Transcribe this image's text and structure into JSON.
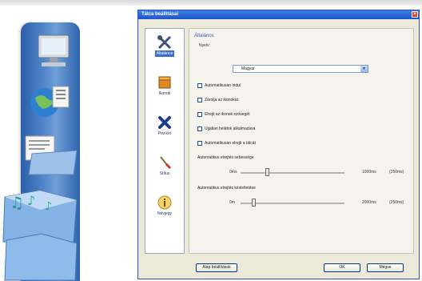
{
  "dialog": {
    "title": "Tálca beállításai",
    "close_glyph": "×"
  },
  "sidebar": {
    "items": [
      {
        "label": "Általános",
        "icon": "tools-icon",
        "active": true
      },
      {
        "label": "Ikonok",
        "icon": "box-icon",
        "active": false
      },
      {
        "label": "Pozíció",
        "icon": "x-icon",
        "active": false
      },
      {
        "label": "Stílus",
        "icon": "brush-icon",
        "active": false
      },
      {
        "label": "Névjegy",
        "icon": "info-icon",
        "active": false
      }
    ]
  },
  "general": {
    "section_title": "Általános",
    "language_label": "Nyelv:",
    "language_value": "Magyar",
    "checkboxes": [
      {
        "label": "Automatikusan indul",
        "checked": false
      },
      {
        "label": "Zárolja az ikonokat",
        "checked": false
      },
      {
        "label": "Elrejti az ikonok szövegét",
        "checked": false
      },
      {
        "label": "Ujjatlan helátok alkalmazása",
        "checked": false
      },
      {
        "label": "Automatikusan elrejti a tálcát",
        "checked": false
      }
    ],
    "slider1": {
      "label": "Automatikus elrejtés sebessége",
      "min": "0ms",
      "max": "1000ms",
      "value": "(250ms)",
      "fraction": 0.25
    },
    "slider2": {
      "label": "Automatikus elrejtés késleltetése",
      "min": "0m",
      "max": "2000ms",
      "value": "(250ms)",
      "fraction": 0.12
    }
  },
  "buttons": {
    "defaults": "Alap beállítások",
    "ok": "OK",
    "cancel": "Mégse"
  }
}
